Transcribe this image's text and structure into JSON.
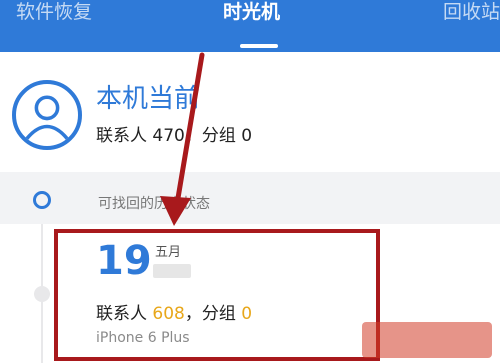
{
  "tabs": [
    {
      "label": "软件恢复",
      "active": false
    },
    {
      "label": "时光机",
      "active": true
    },
    {
      "label": "回收站",
      "active": false
    }
  ],
  "current_device": {
    "title": "本机当前",
    "stats_text": "联系人 470，分组 0"
  },
  "history": {
    "label": "可找回的历史状态"
  },
  "snapshot": {
    "day": "19",
    "month": "五月",
    "contacts_prefix": "联系人 ",
    "contacts_count": "608",
    "groups_prefix": "，分组 ",
    "groups_count": "0",
    "device_model": "iPhone 6 Plus"
  },
  "colors": {
    "accent": "#2f7ad8",
    "highlight_border": "#a8191c",
    "arrow": "#a8191c",
    "count_number": "#e8a71a"
  },
  "icons": {
    "avatar": "person-circle-icon",
    "timeline_dot": "timeline-dot-icon",
    "arrow": "red-arrow-annotation"
  }
}
